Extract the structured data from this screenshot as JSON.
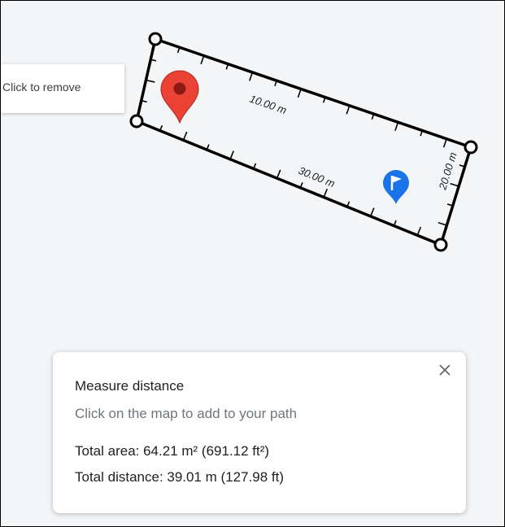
{
  "map": {
    "tooltip_text": "Click to remove",
    "scale_labels": {
      "top_edge": "10.00 m",
      "bottom_edge": "30.00 m",
      "right_edge": "20.00 m"
    },
    "colors": {
      "path": "#000000",
      "red_pin": "#ea4335",
      "blue_flag": "#1a73e8",
      "background": "#f3f5f7"
    }
  },
  "panel": {
    "title": "Measure distance",
    "hint": "Click on the map to add to your path",
    "total_area": "Total area: 64.21 m² (691.12 ft²)",
    "total_distance": "Total distance: 39.01 m (127.98 ft)",
    "close_icon": "close-icon"
  }
}
